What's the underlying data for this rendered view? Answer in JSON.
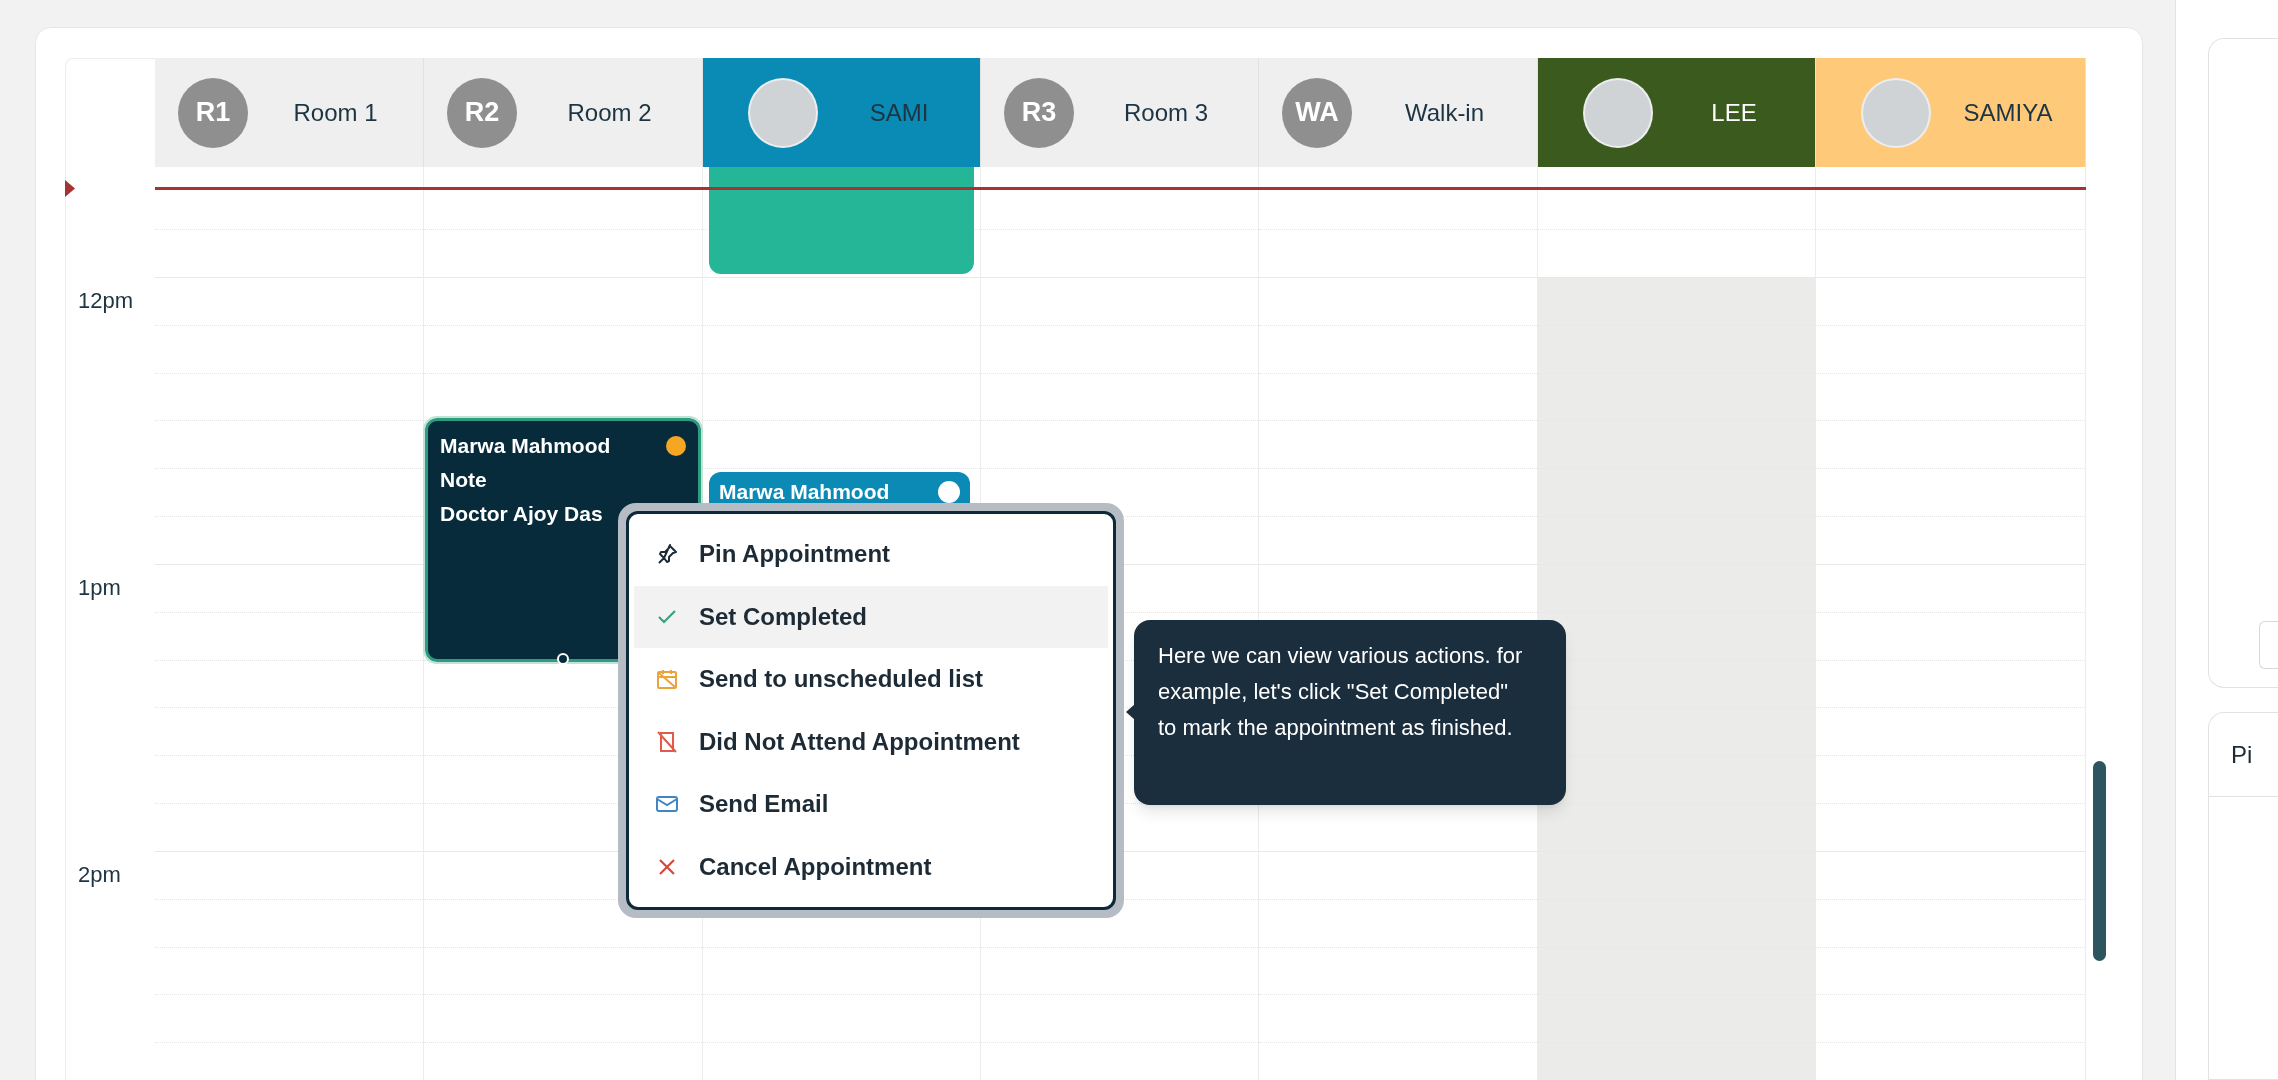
{
  "calendar": {
    "columns": [
      {
        "kind": "initials",
        "initials": "R1",
        "name": "Room 1",
        "color": "#efefef",
        "unavailable": false
      },
      {
        "kind": "initials",
        "initials": "R2",
        "name": "Room 2",
        "color": "#efefef",
        "unavailable": false,
        "events": [
          {
            "kind": "selected",
            "patient": "Marwa Mahmood",
            "lines": [
              "Note",
              "Doctor Ajoy Das"
            ],
            "color": "#f5a623"
          }
        ]
      },
      {
        "kind": "photo",
        "name": "SAMI",
        "color": "#0a8bb5",
        "unavailable": false,
        "events": [
          {
            "kind": "block"
          },
          {
            "kind": "booked",
            "patient": "Marwa Mahmood",
            "color": "#ffffff"
          }
        ]
      },
      {
        "kind": "initials",
        "initials": "R3",
        "name": "Room 3",
        "color": "#efefef",
        "unavailable": false
      },
      {
        "kind": "initials",
        "initials": "WA",
        "name": "Walk-in",
        "color": "#efefef",
        "unavailable": false
      },
      {
        "kind": "photo",
        "name": "LEE",
        "color": "#3b5a1e",
        "unavailable": true
      },
      {
        "kind": "photo",
        "name": "SAMIYA",
        "color": "#ffc97a",
        "unavailable": false
      }
    ],
    "times": [
      "12pm",
      "1pm",
      "2pm"
    ]
  },
  "context_menu": {
    "items": [
      {
        "kind": "pin",
        "label": "Pin Appointment",
        "highlighted": false
      },
      {
        "kind": "complete",
        "label": "Set Completed",
        "highlighted": true
      },
      {
        "kind": "unscheduled",
        "label": "Send to unscheduled list",
        "highlighted": false
      },
      {
        "kind": "dna",
        "label": "Did Not Attend Appointment",
        "highlighted": false
      },
      {
        "kind": "email",
        "label": "Send Email",
        "highlighted": false
      },
      {
        "kind": "cancel",
        "label": "Cancel Appointment",
        "highlighted": false
      }
    ]
  },
  "tooltip": {
    "text": "Here we can view various actions. for example, let's click \"Set Completed\" to mark the appointment as finished."
  },
  "side_panel": {
    "card_title": "Pi"
  }
}
